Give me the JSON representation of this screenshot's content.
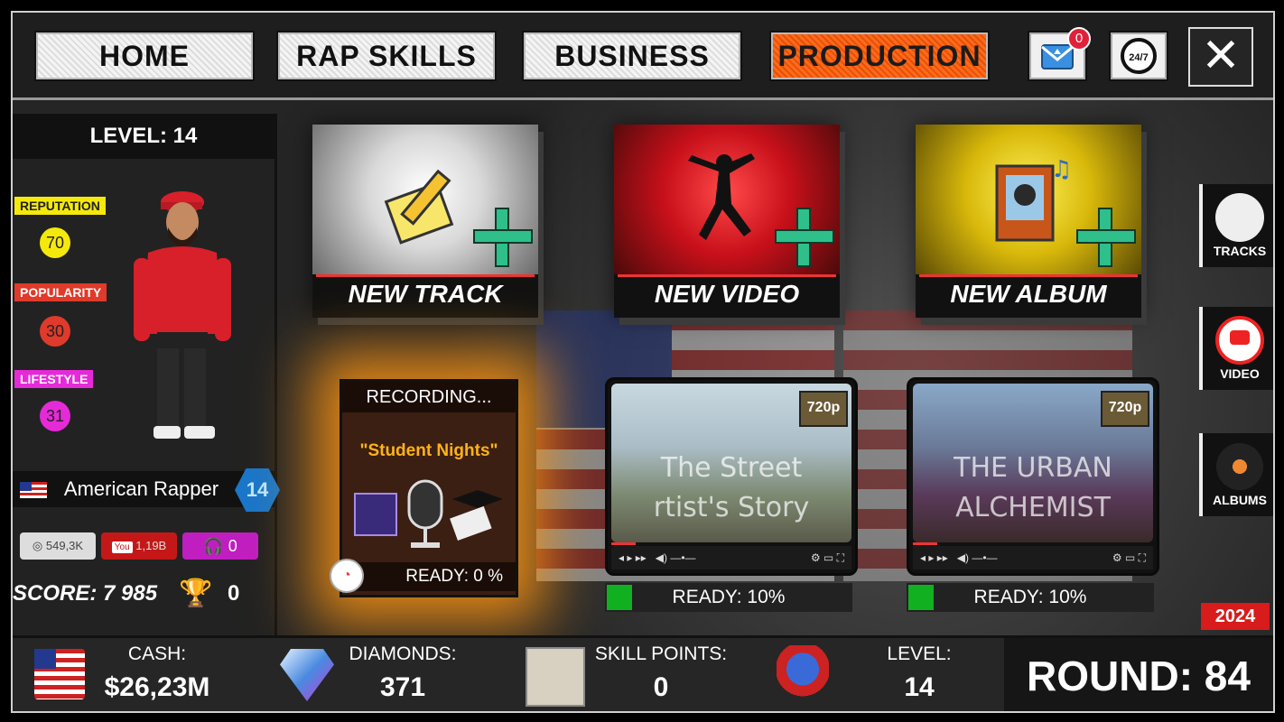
{
  "nav": {
    "tabs": [
      {
        "label": "HOME"
      },
      {
        "label": "RAP SKILLS"
      },
      {
        "label": "BUSINESS"
      },
      {
        "label": "PRODUCTION"
      }
    ],
    "mail_badge": "0",
    "clock_label": "24/7",
    "close_label": "✕"
  },
  "player": {
    "level_label": "LEVEL: 14",
    "reputation_label": "REPUTATION",
    "reputation_value": "70",
    "popularity_label": "POPULARITY",
    "popularity_value": "30",
    "lifestyle_label": "LIFESTYLE",
    "lifestyle_value": "31",
    "name": "American Rapper",
    "hex_level": "14",
    "listeners": "549,3K",
    "youtube": "1,19B",
    "podcast": "0",
    "score": "SCORE: 7 985",
    "trophies": "0"
  },
  "actions": {
    "new_track": "NEW TRACK",
    "new_video": "NEW VIDEO",
    "new_album": "NEW ALBUM"
  },
  "recording": {
    "header": "RECORDING...",
    "song": "\"Student Nights\"",
    "ready": "READY: 0 %",
    "progress": 0
  },
  "videos": [
    {
      "title_line1": "The Street",
      "title_line2": "rtist's Story",
      "quality": "720p",
      "ready": "READY: 10%",
      "progress": 0.1
    },
    {
      "title_line1": "THE URBAN",
      "title_line2": "ALCHEMIST",
      "quality": "720p",
      "ready": "READY: 10%",
      "progress": 0.1
    }
  ],
  "side": {
    "tracks": "TRACKS",
    "video": "VIDEO",
    "albums": "ALBUMS"
  },
  "year": "2024",
  "bottom": {
    "cash_label": "CASH:",
    "cash_value": "$26,23M",
    "diamonds_label": "DIAMONDS:",
    "diamonds_value": "371",
    "skill_label": "SKILL POINTS:",
    "skill_value": "0",
    "level_label": "LEVEL:",
    "level_value": "14",
    "round": "ROUND: 84"
  },
  "colors": {
    "accent_orange": "#ff6a1a",
    "reputation_yellow": "#f5e90c",
    "popularity_red": "#e03a2a",
    "lifestyle_magenta": "#e52ad8",
    "ready_green": "#11b021"
  }
}
